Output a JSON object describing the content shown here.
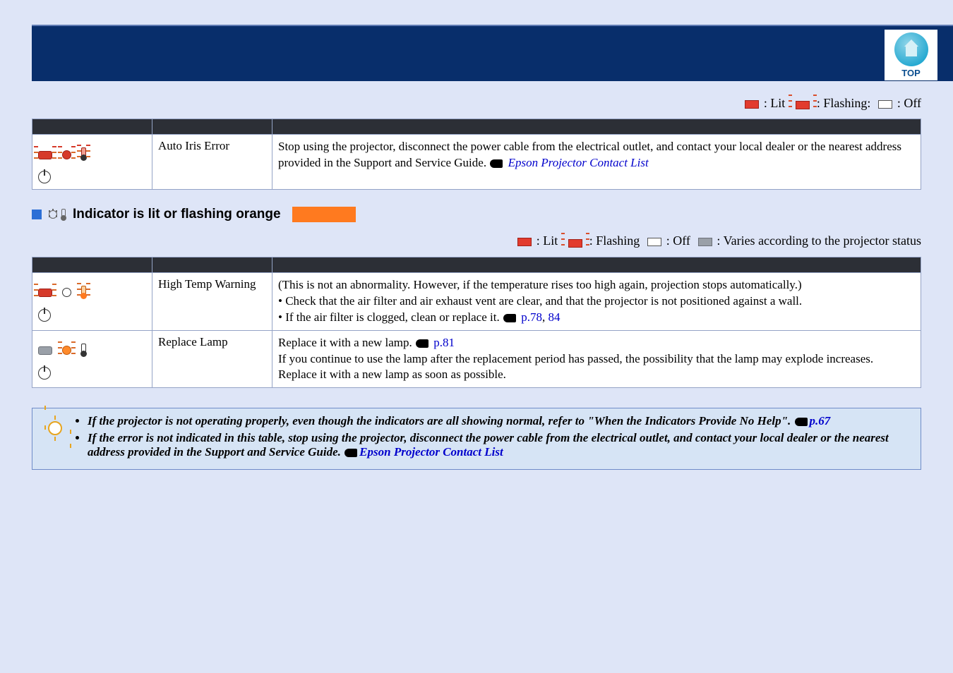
{
  "top": {
    "logo_label": "TOP"
  },
  "legend1": {
    "lit": ": Lit",
    "flashing": ": Flashing:",
    "off": ": Off"
  },
  "legend2": {
    "lit": ": Lit",
    "flashing": ": Flashing",
    "off": ": Off",
    "varies": ": Varies according to the projector status"
  },
  "table1": {
    "rows": [
      {
        "cause": "Auto Iris Error",
        "remedy_a": "Stop using the projector, disconnect the power cable from the electrical outlet, and contact your local dealer or the nearest address provided in the Support and Service Guide. ",
        "remedy_link": "Epson Projector Contact List"
      }
    ]
  },
  "section2_title": "Indicator is lit or flashing orange",
  "table2": {
    "rows": [
      {
        "cause": "High Temp Warning",
        "remedy_a": "(This is not an abnormality. However, if the temperature rises too high again, projection stops automatically.)",
        "remedy_b": "Check that the air filter and air exhaust vent are clear, and that the projector is not positioned against a wall.",
        "remedy_c": "If the air filter is clogged, clean or replace it. ",
        "remedy_link": "p.78",
        "remedy_link2": "84"
      },
      {
        "cause": "Replace Lamp",
        "remedy_a": "Replace it with a new lamp. ",
        "remedy_link": "p.81",
        "remedy_b": "If you continue to use the lamp after the replacement period has passed, the possibility that the lamp may explode increases. Replace it with a new lamp as soon as possible."
      }
    ]
  },
  "tip": {
    "line1_a": "If the projector is not operating properly, even though the indicators are all showing normal, refer to \"When the Indicators Provide No Help\". ",
    "line1_link": "p.67",
    "line2_a": "If the error is not indicated in this table, stop using the projector, disconnect the power cable from the electrical outlet, and contact your local dealer or the nearest address provided in the Support and Service Guide. ",
    "line2_link": "Epson Projector Contact List"
  }
}
